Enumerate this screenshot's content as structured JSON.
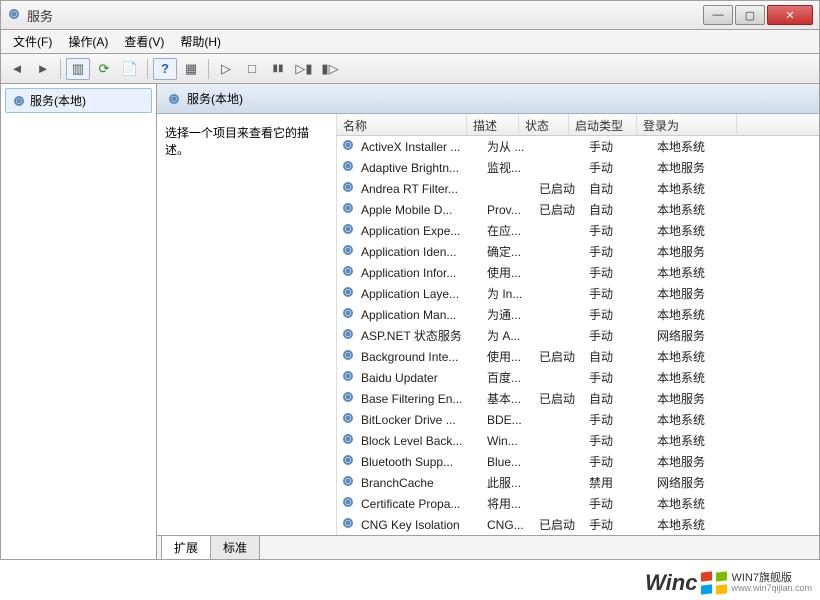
{
  "window": {
    "title": "服务"
  },
  "menu": {
    "file": "文件(F)",
    "action": "操作(A)",
    "view": "查看(V)",
    "help": "帮助(H)"
  },
  "tree": {
    "root": "服务(本地)"
  },
  "panel": {
    "heading": "服务(本地)",
    "desc_prompt": "选择一个项目来查看它的描述。"
  },
  "columns": {
    "name": "名称",
    "desc": "描述",
    "status": "状态",
    "startup": "启动类型",
    "logon": "登录为"
  },
  "tabs": {
    "extended": "扩展",
    "standard": "标准"
  },
  "services": [
    {
      "name": "ActiveX Installer ...",
      "desc": "为从 ...",
      "status": "",
      "startup": "手动",
      "logon": "本地系统"
    },
    {
      "name": "Adaptive Brightn...",
      "desc": "监视...",
      "status": "",
      "startup": "手动",
      "logon": "本地服务"
    },
    {
      "name": "Andrea RT Filter...",
      "desc": "",
      "status": "已启动",
      "startup": "自动",
      "logon": "本地系统"
    },
    {
      "name": "Apple Mobile D...",
      "desc": "Prov...",
      "status": "已启动",
      "startup": "自动",
      "logon": "本地系统"
    },
    {
      "name": "Application Expe...",
      "desc": "在应...",
      "status": "",
      "startup": "手动",
      "logon": "本地系统"
    },
    {
      "name": "Application Iden...",
      "desc": "确定...",
      "status": "",
      "startup": "手动",
      "logon": "本地服务"
    },
    {
      "name": "Application Infor...",
      "desc": "使用...",
      "status": "",
      "startup": "手动",
      "logon": "本地系统"
    },
    {
      "name": "Application Laye...",
      "desc": "为 In...",
      "status": "",
      "startup": "手动",
      "logon": "本地服务"
    },
    {
      "name": "Application Man...",
      "desc": "为通...",
      "status": "",
      "startup": "手动",
      "logon": "本地系统"
    },
    {
      "name": "ASP.NET 状态服务",
      "desc": "为 A...",
      "status": "",
      "startup": "手动",
      "logon": "网络服务"
    },
    {
      "name": "Background Inte...",
      "desc": "使用...",
      "status": "已启动",
      "startup": "自动",
      "logon": "本地系统"
    },
    {
      "name": "Baidu Updater",
      "desc": "百度...",
      "status": "",
      "startup": "手动",
      "logon": "本地系统"
    },
    {
      "name": "Base Filtering En...",
      "desc": "基本...",
      "status": "已启动",
      "startup": "自动",
      "logon": "本地服务"
    },
    {
      "name": "BitLocker Drive ...",
      "desc": "BDE...",
      "status": "",
      "startup": "手动",
      "logon": "本地系统"
    },
    {
      "name": "Block Level Back...",
      "desc": "Win...",
      "status": "",
      "startup": "手动",
      "logon": "本地系统"
    },
    {
      "name": "Bluetooth Supp...",
      "desc": "Blue...",
      "status": "",
      "startup": "手动",
      "logon": "本地服务"
    },
    {
      "name": "BranchCache",
      "desc": "此服...",
      "status": "",
      "startup": "禁用",
      "logon": "网络服务"
    },
    {
      "name": "Certificate Propa...",
      "desc": "将用...",
      "status": "",
      "startup": "手动",
      "logon": "本地系统"
    },
    {
      "name": "CNG Key Isolation",
      "desc": "CNG...",
      "status": "已启动",
      "startup": "手动",
      "logon": "本地系统"
    }
  ],
  "watermark": {
    "brand": "Winc",
    "sub": "WIN7旗舰版",
    "url": "www.win7qijian.com"
  }
}
